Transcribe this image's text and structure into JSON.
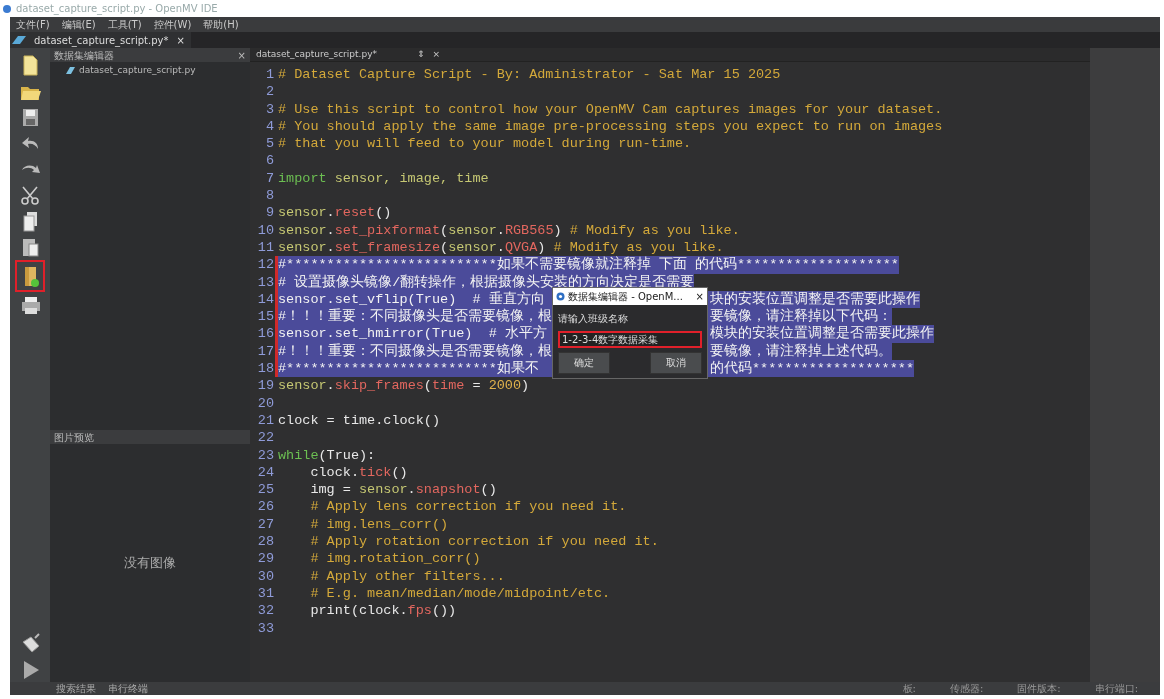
{
  "window": {
    "title": "dataset_capture_script.py - OpenMV IDE"
  },
  "menu": [
    "文件(F)",
    "编辑(E)",
    "工具(T)",
    "控件(W)",
    "帮助(H)"
  ],
  "file_tabs": [
    {
      "label": "dataset_capture_script.py*",
      "close": "×",
      "selected": true
    }
  ],
  "toolbar": [
    {
      "kind": "new-file",
      "highlighted": false
    },
    {
      "kind": "open",
      "highlighted": false
    },
    {
      "kind": "save",
      "highlighted": false
    },
    {
      "kind": "undo",
      "highlighted": false
    },
    {
      "kind": "redo",
      "highlighted": false
    },
    {
      "kind": "cut",
      "highlighted": false
    },
    {
      "kind": "copy",
      "highlighted": false
    },
    {
      "kind": "paste",
      "highlighted": false
    },
    {
      "kind": "dataset",
      "highlighted": true
    },
    {
      "kind": "snapshot",
      "highlighted": false
    }
  ],
  "toolbar_bottom": [
    {
      "kind": "connect",
      "highlighted": false
    },
    {
      "kind": "run",
      "highlighted": false
    }
  ],
  "dataset_panel": {
    "title": "数据集编辑器",
    "close": "×",
    "files": [
      "dataset_capture_script.py"
    ]
  },
  "preview_panel": {
    "title": "图片预览",
    "empty_text": "没有图像"
  },
  "editor": {
    "tab": "dataset_capture_script.py*",
    "split": "⇕",
    "close": "×",
    "lines": [
      {
        "number": "1",
        "selected": false,
        "tokens": [
          {
            "kind": "comment",
            "text": "# Dataset Capture Script - By: Administrator - Sat Mar 15 2025"
          }
        ]
      },
      {
        "number": "2",
        "selected": false
      },
      {
        "number": "3",
        "selected": false,
        "tokens": [
          {
            "kind": "comment",
            "text": "# Use this script to control how your OpenMV Cam captures images for your dataset."
          }
        ]
      },
      {
        "number": "4",
        "selected": false,
        "tokens": [
          {
            "kind": "comment",
            "text": "# You should apply the same image pre-processing steps you expect to run on images"
          }
        ]
      },
      {
        "number": "5",
        "selected": false,
        "tokens": [
          {
            "kind": "comment",
            "text": "# that you will feed to your model during run-time."
          }
        ]
      },
      {
        "number": "6",
        "selected": false
      },
      {
        "number": "7",
        "selected": false,
        "tokens": [
          {
            "kind": "keyword",
            "text": "import"
          },
          {
            "kind": "ident",
            "text": " sensor, image, time"
          }
        ]
      },
      {
        "number": "8",
        "selected": false
      },
      {
        "number": "9",
        "selected": false,
        "tokens": [
          {
            "kind": "ident",
            "text": "sensor"
          },
          {
            "kind": "plain",
            "text": "."
          },
          {
            "kind": "func",
            "text": "reset"
          },
          {
            "kind": "plain",
            "text": "()"
          }
        ]
      },
      {
        "number": "10",
        "selected": false,
        "tokens": [
          {
            "kind": "ident",
            "text": "sensor"
          },
          {
            "kind": "plain",
            "text": "."
          },
          {
            "kind": "func",
            "text": "set_pixformat"
          },
          {
            "kind": "plain",
            "text": "("
          },
          {
            "kind": "ident",
            "text": "sensor"
          },
          {
            "kind": "plain",
            "text": "."
          },
          {
            "kind": "func",
            "text": "RGB565"
          },
          {
            "kind": "plain",
            "text": ") "
          },
          {
            "kind": "comment",
            "text": "# Modify as you like."
          }
        ]
      },
      {
        "number": "11",
        "selected": false,
        "tokens": [
          {
            "kind": "ident",
            "text": "sensor"
          },
          {
            "kind": "plain",
            "text": "."
          },
          {
            "kind": "func",
            "text": "set_framesize"
          },
          {
            "kind": "plain",
            "text": "("
          },
          {
            "kind": "ident",
            "text": "sensor"
          },
          {
            "kind": "plain",
            "text": "."
          },
          {
            "kind": "func",
            "text": "QVGA"
          },
          {
            "kind": "plain",
            "text": ") "
          },
          {
            "kind": "comment",
            "text": "# Modify as you like."
          }
        ]
      },
      {
        "number": "12",
        "selected": true,
        "tokens": [
          {
            "kind": "plain",
            "text": "#**************************如果不需要镜像就注释掉 下面 的代码********************"
          }
        ]
      },
      {
        "number": "13",
        "selected": true,
        "tokens": [
          {
            "kind": "plain",
            "text": "# 设置摄像头镜像/翻转操作，根据摄像头安装的方向决定是否需要"
          }
        ]
      },
      {
        "number": "14",
        "selected": true,
        "tokens": [
          {
            "kind": "plain",
            "text": "sensor.set_vflip(True)  # 垂直方向"
          },
          {
            "kind": "gap"
          },
          {
            "kind": "plain",
            "text": "块的安装位置调整是否需要此操作"
          }
        ]
      },
      {
        "number": "15",
        "selected": true,
        "tokens": [
          {
            "kind": "plain",
            "text": "#！！！重要：不同摄像头是否需要镜像，根"
          },
          {
            "kind": "gap"
          },
          {
            "kind": "plain",
            "text": "要镜像，请注释掉以下代码："
          }
        ]
      },
      {
        "number": "16",
        "selected": true,
        "tokens": [
          {
            "kind": "plain",
            "text": "sensor.set_hmirror(True)  # 水平方"
          },
          {
            "kind": "gap"
          },
          {
            "kind": "plain",
            "text": "模块的安装位置调整是否需要此操作"
          }
        ]
      },
      {
        "number": "17",
        "selected": true,
        "tokens": [
          {
            "kind": "plain",
            "text": "#！！！重要：不同摄像头是否需要镜像，根"
          },
          {
            "kind": "gap"
          },
          {
            "kind": "plain",
            "text": "要镜像，请注释掉上述代码。"
          }
        ]
      },
      {
        "number": "18",
        "selected": true,
        "tokens": [
          {
            "kind": "plain",
            "text": "#**************************如果不"
          },
          {
            "kind": "gap"
          },
          {
            "kind": "plain",
            "text": "的代码********************"
          }
        ]
      },
      {
        "number": "19",
        "selected": false,
        "tokens": [
          {
            "kind": "ident",
            "text": "sensor"
          },
          {
            "kind": "plain",
            "text": "."
          },
          {
            "kind": "func",
            "text": "skip_frames"
          },
          {
            "kind": "plain",
            "text": "("
          },
          {
            "kind": "func",
            "text": "time"
          },
          {
            "kind": "plain",
            "text": " = "
          },
          {
            "kind": "number",
            "text": "2000"
          },
          {
            "kind": "plain",
            "text": ")"
          }
        ]
      },
      {
        "number": "20",
        "selected": false
      },
      {
        "number": "21",
        "selected": false,
        "tokens": [
          {
            "kind": "plain",
            "text": "clock = time.clock()"
          }
        ]
      },
      {
        "number": "22",
        "selected": false
      },
      {
        "number": "23",
        "selected": false,
        "tokens": [
          {
            "kind": "keyword",
            "text": "while"
          },
          {
            "kind": "plain",
            "text": "(True):"
          }
        ]
      },
      {
        "number": "24",
        "selected": false,
        "indented": true,
        "tokens": [
          {
            "kind": "plain",
            "text": "clock."
          },
          {
            "kind": "func",
            "text": "tick"
          },
          {
            "kind": "plain",
            "text": "()"
          }
        ]
      },
      {
        "number": "25",
        "selected": false,
        "indented": true,
        "tokens": [
          {
            "kind": "plain",
            "text": "img = "
          },
          {
            "kind": "ident",
            "text": "sensor"
          },
          {
            "kind": "plain",
            "text": "."
          },
          {
            "kind": "func",
            "text": "snapshot"
          },
          {
            "kind": "plain",
            "text": "()"
          }
        ]
      },
      {
        "number": "26",
        "selected": false,
        "indented": true,
        "tokens": [
          {
            "kind": "comment",
            "text": "# Apply lens correction if you need it."
          }
        ]
      },
      {
        "number": "27",
        "selected": false,
        "indented": true,
        "tokens": [
          {
            "kind": "comment",
            "text": "# img.lens_corr()"
          }
        ]
      },
      {
        "number": "28",
        "selected": false,
        "indented": true,
        "tokens": [
          {
            "kind": "comment",
            "text": "# Apply rotation correction if you need it."
          }
        ]
      },
      {
        "number": "29",
        "selected": false,
        "indented": true,
        "tokens": [
          {
            "kind": "comment",
            "text": "# img.rotation_corr()"
          }
        ]
      },
      {
        "number": "30",
        "selected": false,
        "indented": true,
        "tokens": [
          {
            "kind": "comment",
            "text": "# Apply other filters..."
          }
        ]
      },
      {
        "number": "31",
        "selected": false,
        "indented": true,
        "tokens": [
          {
            "kind": "comment",
            "text": "# E.g. mean/median/mode/midpoint/etc."
          }
        ]
      },
      {
        "number": "32",
        "selected": false,
        "indented": true,
        "tokens": [
          {
            "kind": "plain",
            "text": "print(clock."
          },
          {
            "kind": "func",
            "text": "fps"
          },
          {
            "kind": "plain",
            "text": "())"
          }
        ]
      },
      {
        "number": "33",
        "selected": false
      }
    ]
  },
  "dialog": {
    "title": "数据集编辑器 - OpenM...",
    "close": "×",
    "prompt": "请输入班级名称",
    "value": "1-2-3-4数字数据采集",
    "highlighted": true,
    "buttons": [
      "确定",
      "取消"
    ]
  },
  "bottom_tabs": [
    "搜索结果",
    "串行终端"
  ],
  "status": [
    "板:",
    "传感器:",
    "固件版本:",
    "串行端口:"
  ]
}
